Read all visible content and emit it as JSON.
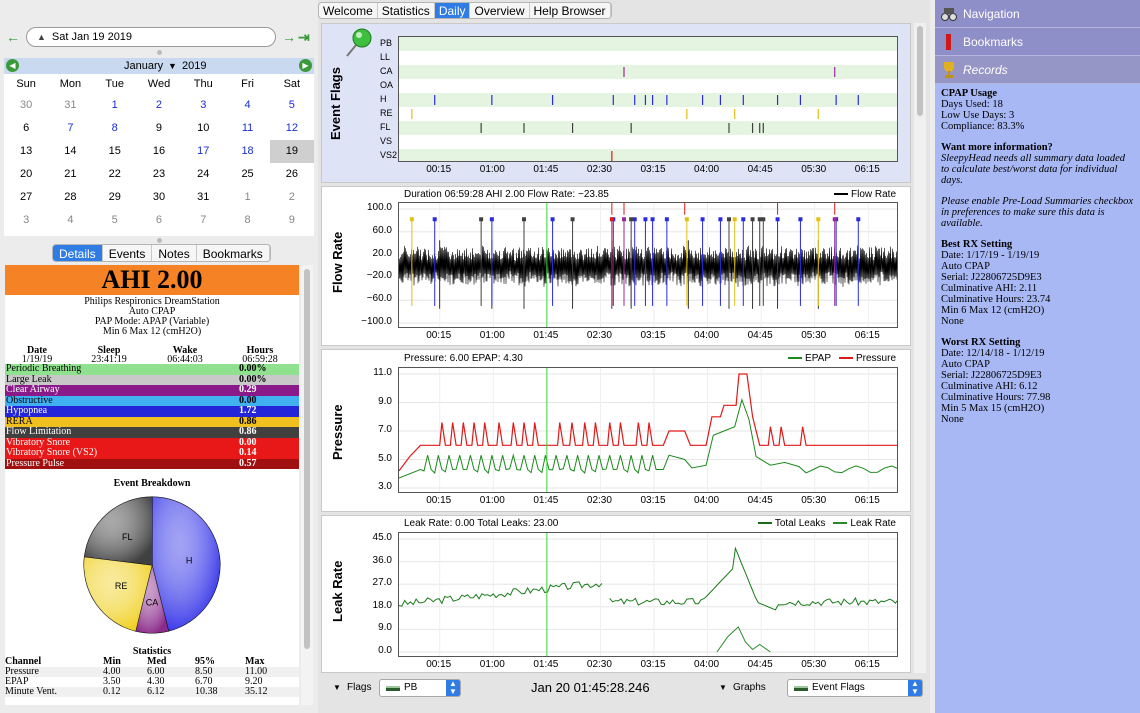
{
  "nav": {
    "back_icon": "arrow-left-icon",
    "date": "Sat Jan 19 2019",
    "fwd_icon": "arrow-right-icon",
    "last_icon": "skip-end-icon"
  },
  "calendar": {
    "month": "January",
    "year": "2019",
    "weekdays": [
      "Sun",
      "Mon",
      "Tue",
      "Wed",
      "Thu",
      "Fri",
      "Sat"
    ],
    "days": [
      [
        "30",
        "o"
      ],
      [
        "31",
        "o"
      ],
      [
        "1",
        "d"
      ],
      [
        "2",
        "d"
      ],
      [
        "3",
        "d"
      ],
      [
        "4",
        "d"
      ],
      [
        "5",
        "d"
      ],
      [
        "6",
        "n"
      ],
      [
        "7",
        "d"
      ],
      [
        "8",
        "d"
      ],
      [
        "9",
        "n"
      ],
      [
        "10",
        "n"
      ],
      [
        "11",
        "d"
      ],
      [
        "12",
        "d"
      ],
      [
        "13",
        "n"
      ],
      [
        "14",
        "n"
      ],
      [
        "15",
        "n"
      ],
      [
        "16",
        "n"
      ],
      [
        "17",
        "d"
      ],
      [
        "18",
        "d"
      ],
      [
        "19",
        "s"
      ],
      [
        "20",
        "n"
      ],
      [
        "21",
        "n"
      ],
      [
        "22",
        "n"
      ],
      [
        "23",
        "n"
      ],
      [
        "24",
        "n"
      ],
      [
        "25",
        "n"
      ],
      [
        "26",
        "n"
      ],
      [
        "27",
        "n"
      ],
      [
        "28",
        "n"
      ],
      [
        "29",
        "n"
      ],
      [
        "30",
        "n"
      ],
      [
        "31",
        "n"
      ],
      [
        "1",
        "o"
      ],
      [
        "2",
        "o"
      ],
      [
        "3",
        "o"
      ],
      [
        "4",
        "o"
      ],
      [
        "5",
        "o"
      ],
      [
        "6",
        "o"
      ],
      [
        "7",
        "o"
      ],
      [
        "8",
        "o"
      ],
      [
        "9",
        "o"
      ]
    ]
  },
  "left_tabs": [
    "Details",
    "Events",
    "Notes",
    "Bookmarks"
  ],
  "details": {
    "ahi": "AHI 2.00",
    "machine": [
      "Philips Respironics DreamStation",
      "Auto CPAP",
      "PAP Mode: APAP (Variable)",
      "Min 6 Max 12 (cmH2O)"
    ],
    "session_headers": [
      "Date",
      "Sleep",
      "Wake",
      "Hours"
    ],
    "session_values": [
      "1/19/19",
      "23:41:19",
      "06:44:03",
      "06:59:28"
    ],
    "events": [
      {
        "name": "Periodic Breathing",
        "value": "0.00%",
        "color": "#8fe08f",
        "text": "#000"
      },
      {
        "name": "Large Leak",
        "value": "0.00%",
        "color": "#c8c8c8",
        "text": "#000"
      },
      {
        "name": "Clear Airway",
        "value": "0.29",
        "color": "#8a1a8a",
        "text": "#fff"
      },
      {
        "name": "Obstructive",
        "value": "0.00",
        "color": "#40b0f0",
        "text": "#000"
      },
      {
        "name": "Hypopnea",
        "value": "1.72",
        "color": "#2424d8",
        "text": "#fff"
      },
      {
        "name": "RERA",
        "value": "0.86",
        "color": "#f0c020",
        "text": "#000"
      },
      {
        "name": "Flow Limitation",
        "value": "0.86",
        "color": "#404040",
        "text": "#fff"
      },
      {
        "name": "Vibratory Snore",
        "value": "0.00",
        "color": "#e81818",
        "text": "#fff"
      },
      {
        "name": "Vibratory Snore (VS2)",
        "value": "0.14",
        "color": "#e81818",
        "text": "#fff"
      },
      {
        "name": "Pressure Pulse",
        "value": "0.57",
        "color": "#a01010",
        "text": "#fff"
      }
    ],
    "breakdown_title": "Event Breakdown",
    "pie": [
      {
        "label": "H",
        "value": 1.72,
        "color": "#3030e8"
      },
      {
        "label": "CA",
        "value": 0.29,
        "color": "#8a2a8a"
      },
      {
        "label": "RE",
        "value": 0.86,
        "color": "#f0d020"
      },
      {
        "label": "FL",
        "value": 0.86,
        "color": "#404040"
      }
    ],
    "stats_title": "Statistics",
    "stats_headers": [
      "Channel",
      "Min",
      "Med",
      "95%",
      "Max"
    ],
    "stats_rows": [
      [
        "Pressure",
        "4.00",
        "6.00",
        "8.50",
        "11.00"
      ],
      [
        "EPAP",
        "3.50",
        "4.30",
        "6.70",
        "9.20"
      ],
      [
        "Minute Vent.",
        "0.12",
        "6.12",
        "10.38",
        "35.12"
      ]
    ]
  },
  "top_tabs": [
    "Welcome",
    "Statistics",
    "Daily",
    "Overview",
    "Help Browser"
  ],
  "x_ticks": [
    "00:15",
    "01:00",
    "01:45",
    "02:30",
    "03:15",
    "04:00",
    "04:45",
    "05:30",
    "06:15"
  ],
  "event_flags": {
    "title": "Event Flags",
    "pin_icon": "pushpin-icon",
    "rows": [
      "PB",
      "LL",
      "CA",
      "OA",
      "H",
      "RE",
      "FL",
      "VS",
      "VS2"
    ],
    "marks": {
      "CA": {
        "color": "#9a2a9a",
        "t": [
          3.15,
          6.1
        ]
      },
      "H": {
        "color": "#2a2ae0",
        "t": [
          0.5,
          1.3,
          2.15,
          3.0,
          3.3,
          3.45,
          3.55,
          3.75,
          4.25,
          4.5,
          4.82,
          5.3,
          5.62,
          6.12,
          6.43
        ]
      },
      "RE": {
        "color": "#e0c010",
        "t": [
          0.18,
          4.03,
          4.7,
          5.87
        ]
      },
      "FL": {
        "color": "#404040",
        "t": [
          1.15,
          1.75,
          2.43,
          3.25,
          4.62,
          4.95,
          5.05,
          5.1
        ]
      },
      "VS2": {
        "color": "#e01818",
        "t": [
          2.98
        ]
      }
    }
  },
  "flow_rate": {
    "ylabel": "Flow Rate",
    "header": "Duration 06:59:28 AHI 2.00 Flow Rate: −23.85",
    "legend": "Flow Rate",
    "yticks": [
      "100.0",
      "60.0",
      "20.0",
      "−20.0",
      "−60.0",
      "−100.0"
    ]
  },
  "pressure": {
    "ylabel": "Pressure",
    "header": "Pressure: 6.00 EPAP: 4.30",
    "legend": [
      "EPAP",
      "Pressure"
    ],
    "colors": {
      "epap": "#1a8a1a",
      "pressure": "#e01818"
    },
    "yticks": [
      "11.0",
      "9.0",
      "7.0",
      "5.0",
      "3.0"
    ]
  },
  "leak_rate": {
    "ylabel": "Leak Rate",
    "header": "Leak Rate: 0.00 Total Leaks: 23.00",
    "legend": [
      "Total Leaks",
      "Leak Rate"
    ],
    "yticks": [
      "45.0",
      "36.0",
      "27.0",
      "18.0",
      "9.0",
      "0.0"
    ]
  },
  "bottom": {
    "flags_label": "Flags",
    "flags_value": "PB",
    "time": "Jan 20 01:45:28.246",
    "graphs_label": "Graphs",
    "graphs_value": "Event Flags"
  },
  "right_nav": [
    {
      "label": "Navigation",
      "icon": "binoculars-icon"
    },
    {
      "label": "Bookmarks",
      "icon": "bookmark-icon"
    },
    {
      "label": "Records",
      "icon": "trophy-icon"
    }
  ],
  "records": {
    "usage_title": "CPAP Usage",
    "usage": [
      "Days Used: 18",
      "Low Use Days: 3",
      "Compliance: 83.3%"
    ],
    "info_title": "Want more information?",
    "info1": "SleepyHead needs all summary data loaded to calculate best/worst data for individual days.",
    "info2": "Please enable Pre-Load Summaries checkbox in preferences to make sure this data is available.",
    "best_title": "Best RX Setting",
    "best": [
      "Date: 1/17/19 - 1/19/19",
      "Auto CPAP",
      "Serial: J22806725D9E3",
      "Culminative AHI: 2.11",
      "Culminative Hours: 23.74",
      "Min 6 Max 12 (cmH2O)",
      "None"
    ],
    "worst_title": "Worst RX Setting",
    "worst": [
      "Date: 12/14/18 - 1/12/19",
      "Auto CPAP",
      "Serial: J22806725D9E3",
      "Culminative AHI: 6.12",
      "Culminative Hours: 77.98",
      "Min 5 Max 15 (cmH2O)",
      "None"
    ]
  }
}
